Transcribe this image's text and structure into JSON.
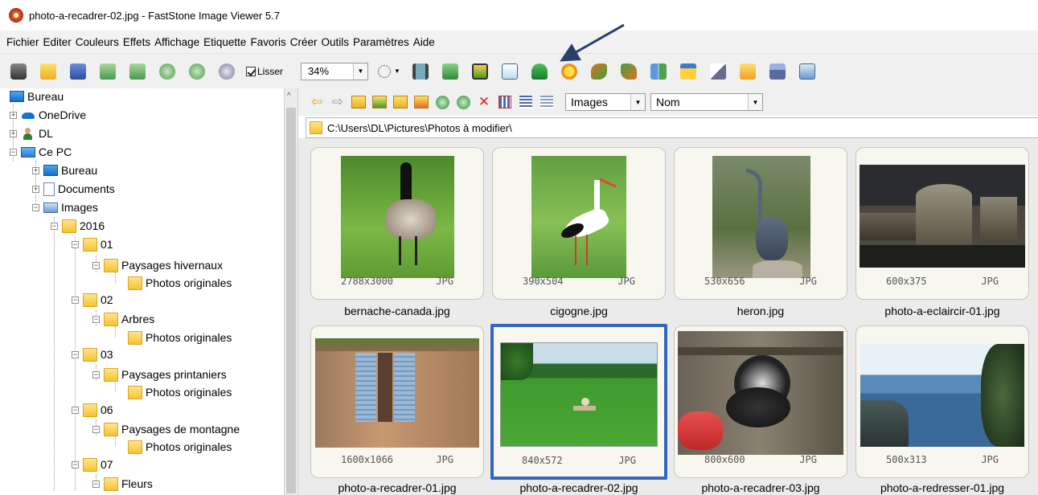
{
  "window": {
    "title": "photo-a-recadrer-02.jpg  -  FastStone Image Viewer 5.7"
  },
  "menu": [
    "Fichier",
    "Editer",
    "Couleurs",
    "Effets",
    "Affichage",
    "Etiquette",
    "Favoris",
    "Créer",
    "Outils",
    "Paramètres",
    "Aide"
  ],
  "toolbar": {
    "lisser_label": "Lisser",
    "lisser_checked": true,
    "zoom_value": "34%",
    "buttons": [
      "camera-icon",
      "open-folder-icon",
      "save-icon",
      "previous-icon",
      "next-icon",
      "zoom-in-icon",
      "zoom-out-icon",
      "actual-size-icon"
    ],
    "right_buttons": [
      "film-strip-icon",
      "resize-icon",
      "crop-icon",
      "text-icon",
      "stamp-icon",
      "sun-icon",
      "rotate-left-icon",
      "rotate-right-icon",
      "compare-icon",
      "window-icon",
      "draw-icon",
      "email-icon",
      "print-icon",
      "settings-icon"
    ]
  },
  "tree": [
    {
      "label": "Bureau",
      "icon": "desktop-icon"
    },
    {
      "label": "OneDrive",
      "icon": "cloud-icon"
    },
    {
      "label": "DL",
      "icon": "user-icon"
    },
    {
      "label": "Ce PC",
      "icon": "computer-icon"
    },
    {
      "label": "Bureau",
      "icon": "desktop-icon"
    },
    {
      "label": "Documents",
      "icon": "document-icon"
    },
    {
      "label": "Images",
      "icon": "pictures-icon"
    },
    {
      "label": "2016",
      "icon": "folder-icon"
    },
    {
      "label": "01",
      "icon": "folder-icon"
    },
    {
      "label": "Paysages hivernaux",
      "icon": "folder-icon"
    },
    {
      "label": "Photos originales",
      "icon": "folder-icon"
    },
    {
      "label": "02",
      "icon": "folder-icon"
    },
    {
      "label": "Arbres",
      "icon": "folder-icon"
    },
    {
      "label": "Photos originales",
      "icon": "folder-icon"
    },
    {
      "label": "03",
      "icon": "folder-icon"
    },
    {
      "label": "Paysages printaniers",
      "icon": "folder-icon"
    },
    {
      "label": "Photos originales",
      "icon": "folder-icon"
    },
    {
      "label": "06",
      "icon": "folder-icon"
    },
    {
      "label": "Paysages de montagne",
      "icon": "folder-icon"
    },
    {
      "label": "Photos originales",
      "icon": "folder-icon"
    },
    {
      "label": "07",
      "icon": "folder-icon"
    },
    {
      "label": "Fleurs",
      "icon": "folder-icon"
    }
  ],
  "browser": {
    "filter": "Images",
    "sort": "Nom",
    "path": "C:\\Users\\DL\\Pictures\\Photos à modifier\\",
    "nav_buttons": [
      "back-icon",
      "forward-icon",
      "up-folder-icon",
      "favorite-folder-icon",
      "new-folder-icon",
      "folder-options-icon",
      "copy-to-icon",
      "move-to-icon",
      "delete-icon",
      "thumbnails-view-icon",
      "details-view-icon",
      "list-view-icon"
    ]
  },
  "thumbnails": [
    {
      "name": "bernache-canada.jpg",
      "dims": "2788x3000",
      "type": "JPG",
      "selected": false,
      "subject": "canada-goose-photo"
    },
    {
      "name": "cigogne.jpg",
      "dims": "390x504",
      "type": "JPG",
      "selected": false,
      "subject": "stork-photo"
    },
    {
      "name": "heron.jpg",
      "dims": "530x656",
      "type": "JPG",
      "selected": false,
      "subject": "heron-photo"
    },
    {
      "name": "photo-a-eclaircir-01.jpg",
      "dims": "600x375",
      "type": "JPG",
      "selected": false,
      "subject": "castle-photo"
    },
    {
      "name": "photo-a-recadrer-01.jpg",
      "dims": "1600x1066",
      "type": "JPG",
      "selected": false,
      "subject": "shutters-photo"
    },
    {
      "name": "photo-a-recadrer-02.jpg",
      "dims": "840x572",
      "type": "JPG",
      "selected": true,
      "subject": "park-lawn-photo"
    },
    {
      "name": "photo-a-recadrer-03.jpg",
      "dims": "800x600",
      "type": "JPG",
      "selected": false,
      "subject": "hen-photo"
    },
    {
      "name": "photo-a-redresser-01.jpg",
      "dims": "500x313",
      "type": "JPG",
      "selected": false,
      "subject": "seaside-photo"
    }
  ],
  "colors": {
    "selection": "#3466c0",
    "thumb_bg": "#ebebeb",
    "card_bg": "#f7f6ef",
    "annotation_arrow": "#2a3f6a"
  }
}
